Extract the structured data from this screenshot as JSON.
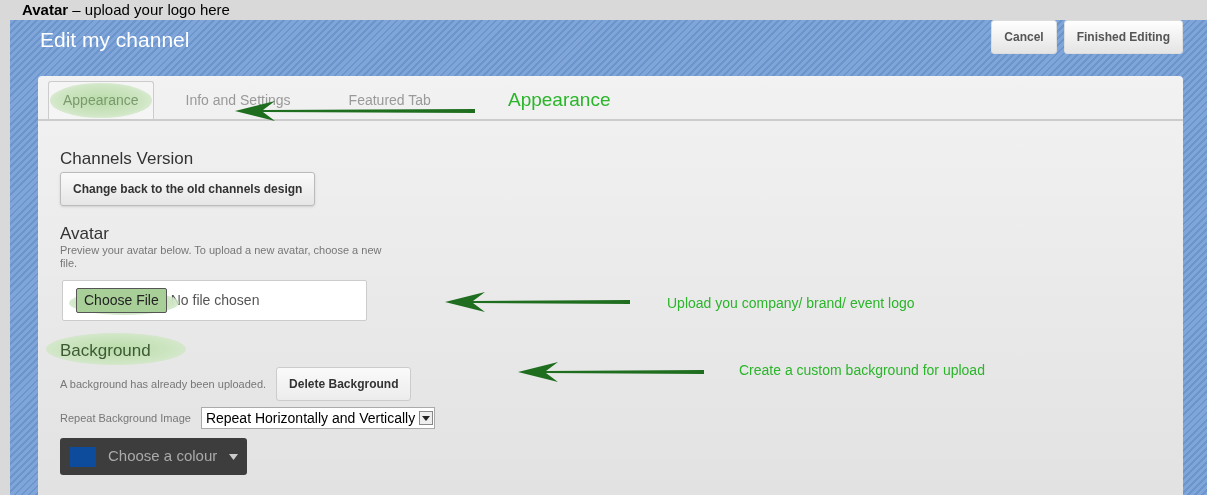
{
  "caption": {
    "bold": "Avatar",
    "rest": "– upload your logo here"
  },
  "header": {
    "title": "Edit my channel",
    "buttons": [
      "Cancel",
      "Finished Editing"
    ]
  },
  "tabs": [
    {
      "label": "Appearance",
      "selected": true,
      "highlighted": true
    },
    {
      "label": "Info and Settings",
      "selected": false,
      "highlighted": false
    },
    {
      "label": "Featured Tab",
      "selected": false,
      "highlighted": false
    }
  ],
  "sections": [
    {
      "kind": "version",
      "title": "Channels Version",
      "button": "Change back to the old channels design"
    },
    {
      "kind": "avatar",
      "title": "Avatar",
      "description": "Preview your avatar below. To upload a new avatar, choose a new file.",
      "file_button": "Choose File",
      "file_status": "No file chosen"
    },
    {
      "kind": "background",
      "title": "Background",
      "status": "A background has already been uploaded.",
      "button": "Delete Background",
      "select_label": "Repeat Background Image",
      "select_value": "Repeat Horizontally and Vertically",
      "colour_button": "Choose a colour"
    }
  ],
  "annotations": [
    "Appearance",
    "Upload you company/ brand/ event logo",
    "Create a custom background for upload"
  ]
}
